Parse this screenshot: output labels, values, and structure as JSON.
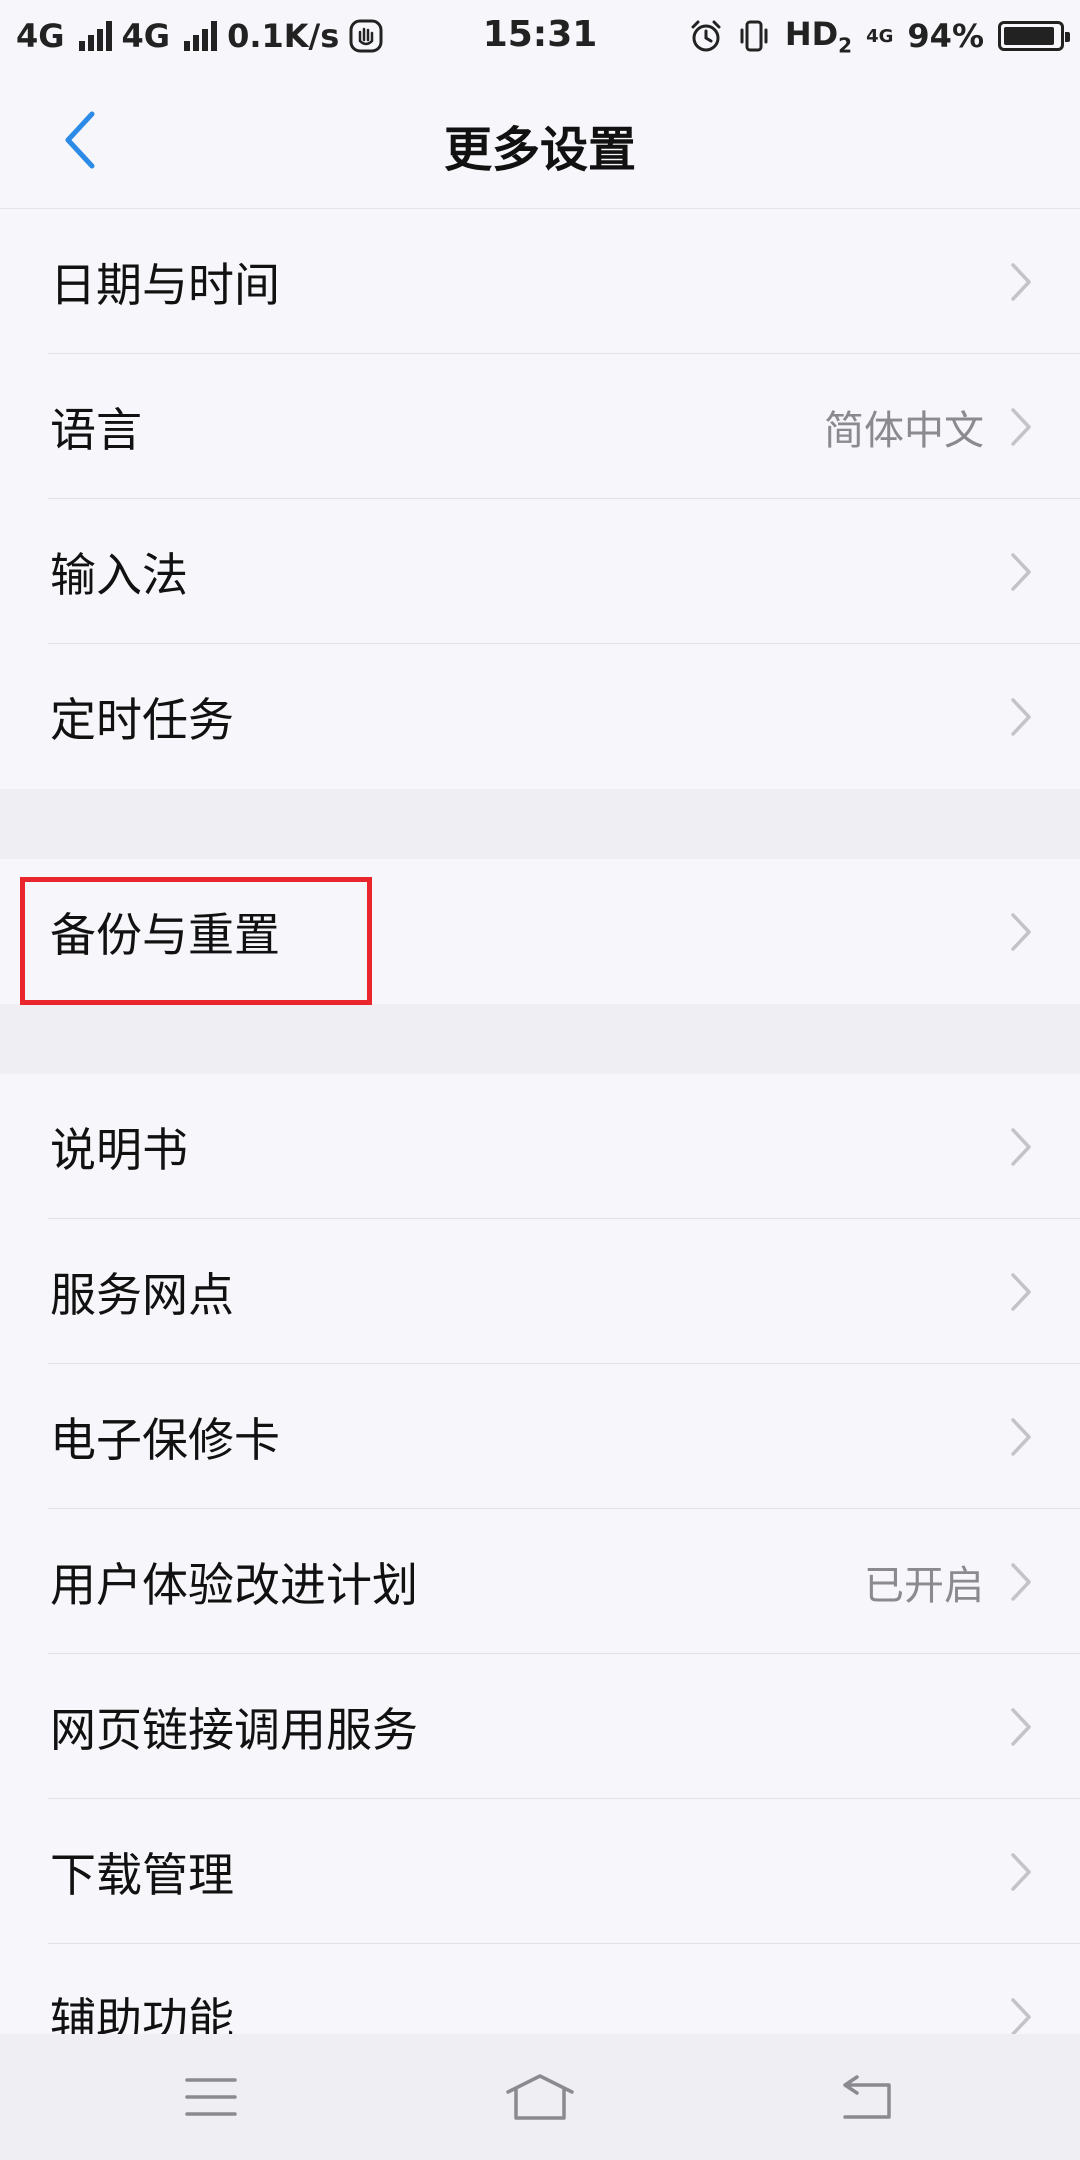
{
  "status_bar": {
    "network1": "4G",
    "network2": "4G",
    "speed": "0.1K/s",
    "time": "15:31",
    "hd": "HD",
    "hd_sub": "2",
    "net_small": "4G",
    "battery": "94%",
    "battery_level": 0.94
  },
  "header": {
    "title": "更多设置"
  },
  "groups": [
    {
      "items": [
        {
          "label": "日期与时间",
          "value": ""
        },
        {
          "label": "语言",
          "value": "简体中文"
        },
        {
          "label": "输入法",
          "value": ""
        },
        {
          "label": "定时任务",
          "value": ""
        }
      ]
    },
    {
      "items": [
        {
          "label": "备份与重置",
          "value": ""
        }
      ]
    },
    {
      "items": [
        {
          "label": "说明书",
          "value": ""
        },
        {
          "label": "服务网点",
          "value": ""
        },
        {
          "label": "电子保修卡",
          "value": ""
        },
        {
          "label": "用户体验改进计划",
          "value": "已开启"
        },
        {
          "label": "网页链接调用服务",
          "value": ""
        },
        {
          "label": "下载管理",
          "value": ""
        },
        {
          "label": "辅助功能",
          "value": ""
        }
      ]
    }
  ],
  "colors": {
    "accent": "#2b8be6",
    "highlight": "#e8262b",
    "background": "#f7f6fa",
    "separator": "#efeef3"
  }
}
